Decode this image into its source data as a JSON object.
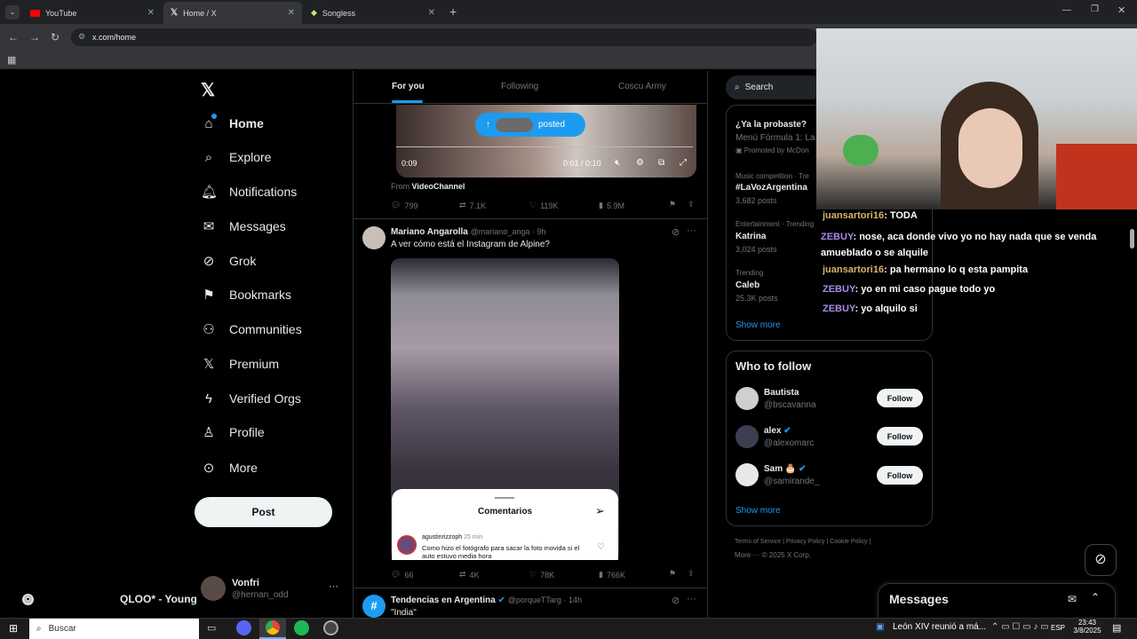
{
  "browser": {
    "tabs": [
      {
        "label": "YouTube"
      },
      {
        "label": "Home / X"
      },
      {
        "label": "Songless"
      }
    ],
    "url": "x.com/home"
  },
  "sidebar": {
    "items": [
      {
        "label": "Home"
      },
      {
        "label": "Explore"
      },
      {
        "label": "Notifications"
      },
      {
        "label": "Messages"
      },
      {
        "label": "Grok"
      },
      {
        "label": "Bookmarks"
      },
      {
        "label": "Communities"
      },
      {
        "label": "Premium"
      },
      {
        "label": "Verified Orgs"
      },
      {
        "label": "Profile"
      },
      {
        "label": "More"
      }
    ],
    "post_label": "Post",
    "account": {
      "name": "Vonfri",
      "handle": "@hernan_odd"
    }
  },
  "feed": {
    "tabs": [
      {
        "label": "For you"
      },
      {
        "label": "Following"
      },
      {
        "label": "Coscu Army"
      }
    ],
    "posted_pill": "posted",
    "video": {
      "time_start": "0:09",
      "time": "0:01 / 0:10"
    },
    "from_label": "From",
    "from_channel": "VideoChannel",
    "tweet1_actions": {
      "replies": "799",
      "retweets": "7.1K",
      "likes": "119K",
      "views": "5.9M"
    },
    "tweet2": {
      "name": "Mariano Angarolla",
      "handle": "@mariano_anga",
      "time": "9h",
      "text": "A ver cómo está el Instagram de Alpine?"
    },
    "comments_panel": {
      "title": "Comentarios",
      "comment_user": "agustinrizzoph",
      "comment_time": "25 min",
      "comment_text": "Como hizo el fotógrafo para sacar la foto movida si el auto estuvo media hora"
    },
    "tweet2_actions": {
      "replies": "66",
      "retweets": "4K",
      "likes": "78K",
      "views": "766K"
    },
    "tweet3": {
      "name": "Tendencias en Argentina",
      "handle": "@porqueTTarg",
      "time": "14h",
      "text": "\"India\""
    }
  },
  "right": {
    "search_placeholder": "Search",
    "trends": [
      {
        "head": "",
        "title": "¿Ya la probaste?",
        "sub": "Menú Fórmula 1: La",
        "extra": "Promoted by McDon"
      },
      {
        "head": "Music competition · Tre",
        "title": "#LaVozArgentina",
        "sub": "3,682 posts"
      },
      {
        "head": "Entertainment · Trending",
        "title": "Katrina",
        "sub": "3,024 posts"
      },
      {
        "head": "Trending",
        "title": "Caleb",
        "sub": "25.3K posts"
      }
    ],
    "show_more": "Show more",
    "who_title": "Who to follow",
    "who": [
      {
        "name": "Bautista",
        "handle": "@bscavanna",
        "btn": "Follow"
      },
      {
        "name": "alex",
        "handle": "@alexomarc",
        "btn": "Follow"
      },
      {
        "name": "Sam 🎂",
        "handle": "@samirande_",
        "btn": "Follow"
      }
    ],
    "show_more2": "Show more",
    "footer1": [
      "Terms of Service",
      "Privacy Policy",
      "Cookie Policy"
    ],
    "footer2": "More ···",
    "footer_copy": "© 2025 X Corp.",
    "messages_label": "Messages"
  },
  "chat": [
    {
      "user": "juansartori16",
      "text": ": TODA"
    },
    {
      "user": "ZEBUY",
      "text": ": nose, aca donde vivo yo no hay nada que se venda amueblado o se alquile"
    },
    {
      "user": "juansartori16",
      "text": ": pa hermano lo q esta pampita"
    },
    {
      "user": "ZEBUY",
      "text": ": yo en mi caso pague todo yo"
    },
    {
      "user": "ZEBUY",
      "text": ": yo alquilo si"
    }
  ],
  "now_playing": "QLOO* - Young C",
  "taskbar": {
    "search": "Buscar",
    "news": "León XIV reunió a má...",
    "lang": "ESP",
    "time": "23:43",
    "date": "3/8/2025"
  }
}
